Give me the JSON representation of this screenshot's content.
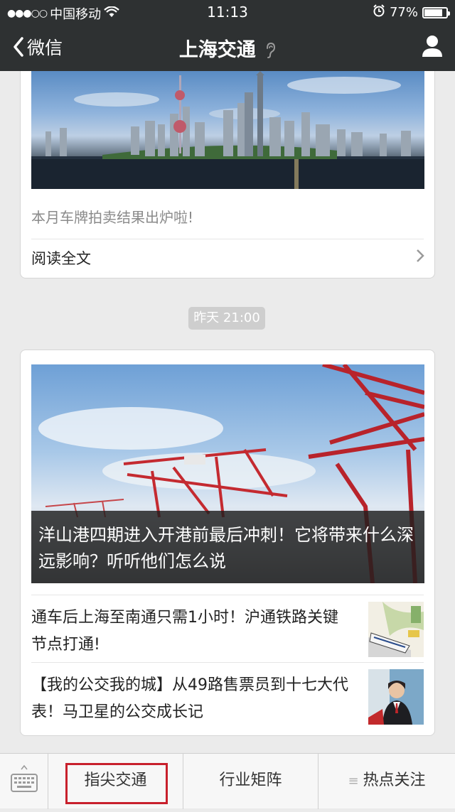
{
  "status_bar": {
    "signal": "●●●○○",
    "carrier": "中国移动",
    "time": "11:13",
    "battery_percent": "77%",
    "battery_level": 0.77
  },
  "nav": {
    "back_label": "微信",
    "title": "上海交通"
  },
  "card1": {
    "summary": "本月车牌拍卖结果出炉啦!",
    "read_all": "阅读全文"
  },
  "timestamp": "昨天 21:00",
  "card2": {
    "headline": "洋山港四期进入开港前最后冲刺！它将带来什么深远影响？听听他们怎么说",
    "articles": [
      {
        "title": "通车后上海至南通只需1小时！沪通铁路关键节点打通!"
      },
      {
        "title": "【我的公交我的城】从49路售票员到十七大代表！马卫星的公交成长记"
      }
    ]
  },
  "menu": {
    "tabs": [
      {
        "label": "指尖交通"
      },
      {
        "label": "行业矩阵"
      },
      {
        "label": "热点关注"
      }
    ]
  },
  "colors": {
    "nav_bg": "#2e3132",
    "highlight": "#c8202c",
    "page_bg": "#ebebeb"
  }
}
